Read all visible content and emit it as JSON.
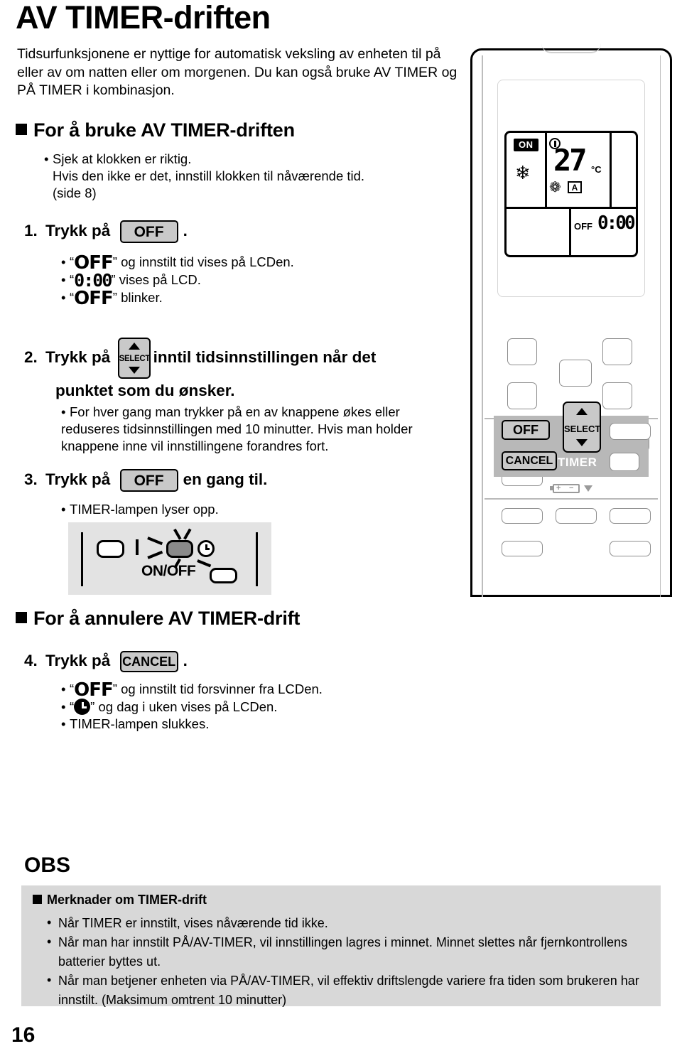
{
  "page": {
    "title": "AV TIMER-driften",
    "number": "16",
    "intro": "Tidsurfunksjonene er nyttige for automatisk veksling av enheten til på eller av om natten eller om morgenen. Du kan også bruke AV TIMER og PÅ TIMER i kombinasjon."
  },
  "section_use": {
    "heading": "For å bruke AV TIMER-driften",
    "precheck": {
      "line1": "Sjek at klokken er riktig.",
      "line2": "Hvis den ikke er det, innstill klokken til nåværende tid.",
      "line3": "(side 8)"
    },
    "step1": {
      "num": "1.",
      "text_before": "Trykk på",
      "button_label": "OFF",
      "text_after": ".",
      "notes": [
        {
          "glyph": "OFF",
          "text": "og innstilt tid vises på LCDen."
        },
        {
          "glyph": "0:00",
          "text": "vises på LCD."
        },
        {
          "glyph": "OFF",
          "text": "blinker."
        }
      ]
    },
    "step2": {
      "num": "2.",
      "text_before": "Trykk på",
      "button_label": "SELECT",
      "text_after": "inntil tidsinnstillingen når det",
      "line2": "punktet som du ønsker.",
      "note": "For hver gang man trykker på en av knappene økes eller reduseres tidsinnstillingen med 10 minutter. Hvis man holder knappene inne vil innstillingene forandres fort."
    },
    "step3": {
      "num": "3.",
      "text_before": "Trykk på",
      "button_label": "OFF",
      "text_after": "en gang til.",
      "note": "TIMER-lampen lyser opp."
    }
  },
  "indicator_illustration": {
    "label": "ON/OFF",
    "timer_lamp_icon": "timer-clock-icon",
    "operation_lamp_icon": "lamp-icon"
  },
  "section_cancel": {
    "heading": "For å annulere AV TIMER-drift",
    "step4": {
      "num": "4.",
      "text_before": "Trykk på",
      "button_label": "CANCEL",
      "text_after": ".",
      "notes": [
        {
          "glyph": "OFF",
          "text": "og innstilt tid forsvinner fra LCDen."
        },
        {
          "glyph": "clock-icon",
          "text": "og dag i uken vises på LCDen."
        },
        {
          "glyph": "",
          "text": "TIMER-lampen slukkes."
        }
      ]
    }
  },
  "obs": {
    "title": "OBS",
    "heading": "Merknader om TIMER-drift",
    "notes": [
      "Når TIMER er innstilt, vises nåværende tid ikke.",
      "Når man har innstilt PÅ/AV-TIMER, vil innstillingen lagres i minnet. Minnet slettes når fjernkontrollens batterier byttes ut.",
      "Når man betjener enheten via PÅ/AV-TIMER, vil effektiv driftslengde variere fra tiden som brukeren har innstilt. (Maksimum omtrent 10 minutter)"
    ]
  },
  "remote": {
    "lcd": {
      "on_badge": "ON",
      "mode_icon": "snowflake-icon",
      "mode_glyph": "❄",
      "thermometer_icon": "thermometer-icon",
      "temperature": "27",
      "unit": "°C",
      "fan_icon": "fan-icon",
      "fan_glyph": "❁",
      "fan_speed": "A",
      "timer_mode": "OFF",
      "timer_value": "0:00"
    },
    "buttons": {
      "off": "OFF",
      "cancel": "CANCEL",
      "select": "SELECT",
      "timer_zone_label": "TIMER"
    },
    "battery_icon": "battery-icon"
  },
  "colors": {
    "keycap_fill": "#c9c9c9",
    "timer_zone": "#b8b8b8",
    "obs_box": "#d8d8d8",
    "indicator_box": "#e3e3e3",
    "lamp_active": "#8a8a8a"
  }
}
